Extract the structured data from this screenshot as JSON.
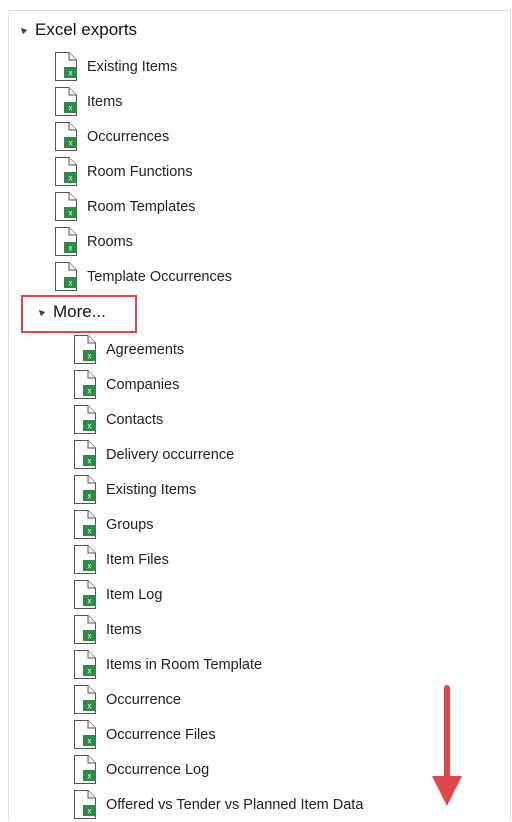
{
  "tree": {
    "root_label": "Excel exports",
    "root_items": [
      "Existing Items",
      "Items",
      "Occurrences",
      "Room Functions",
      "Room Templates",
      "Rooms",
      "Template Occurrences"
    ],
    "more_label": "More...",
    "more_items": [
      "Agreements",
      "Companies",
      "Contacts",
      "Delivery occurrence",
      "Existing Items",
      "Groups",
      "Item Files",
      "Item Log",
      "Items",
      "Items in Room Template",
      "Occurrence",
      "Occurrence Files",
      "Occurrence Log",
      "Offered vs Tender vs Planned Item Data"
    ],
    "excel_badge_letter": "x"
  },
  "colors": {
    "excel_green": "#2e8a47",
    "highlight_red": "#e0474c",
    "arrow_red": "#e0474c"
  },
  "icons": {
    "file": "excel-file-icon",
    "expander": "expand-triangle-icon",
    "annotation": "scroll-down-arrow-icon"
  }
}
